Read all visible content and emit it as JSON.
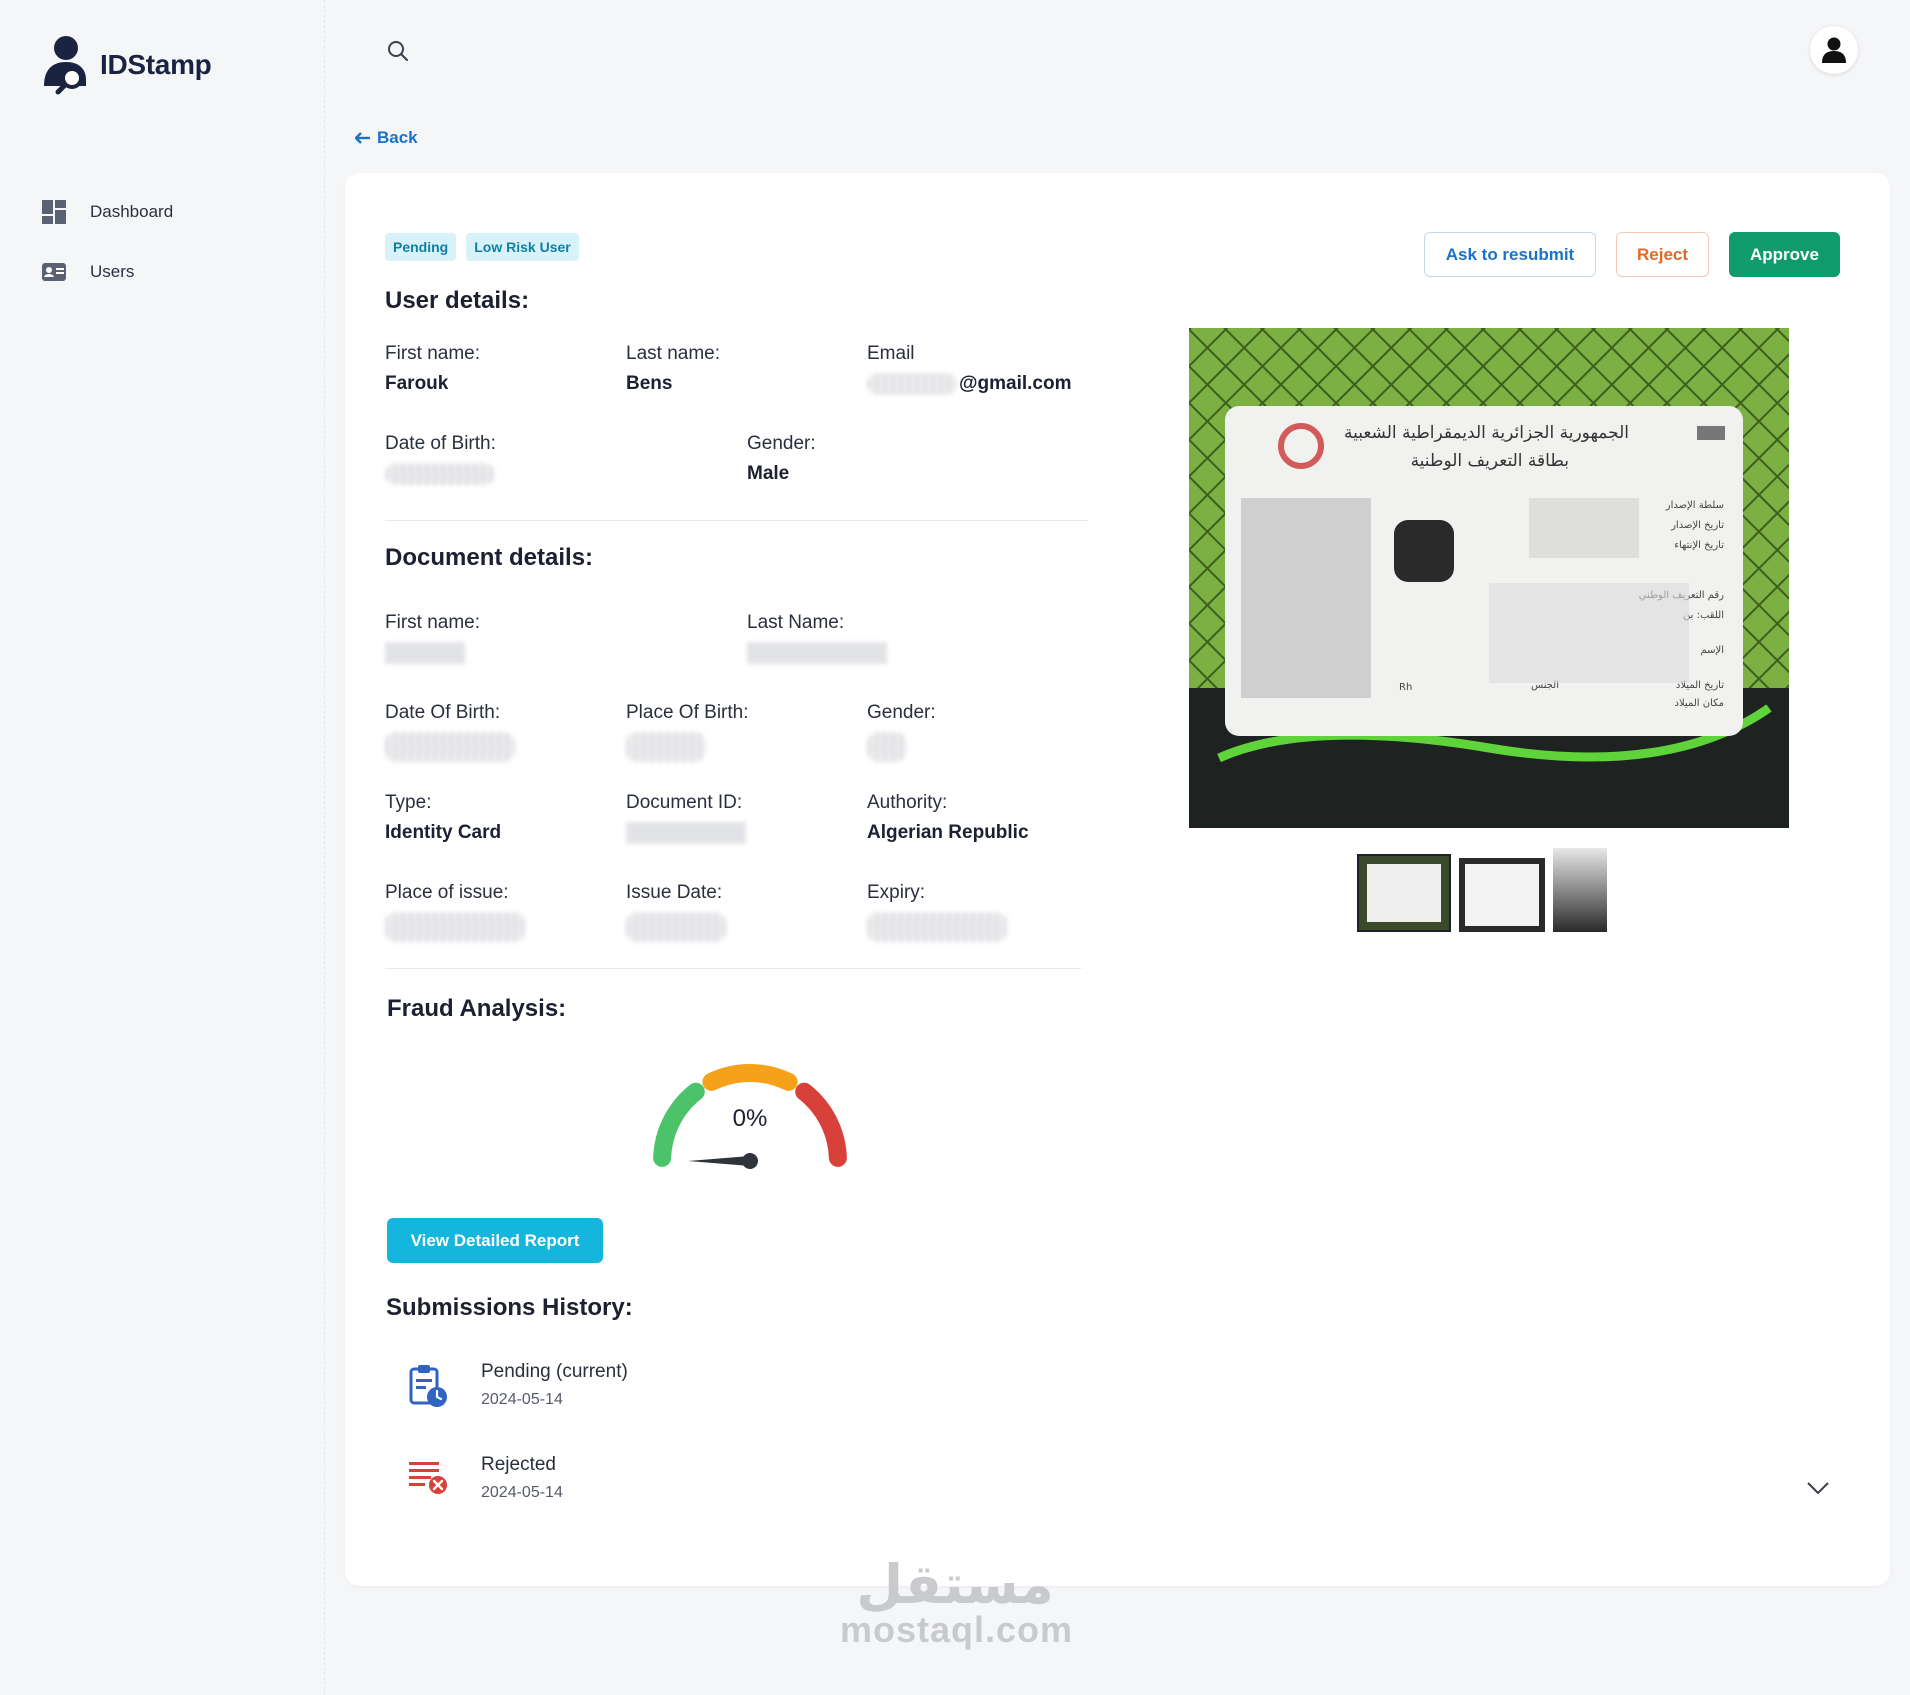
{
  "app": {
    "name": "IDStamp"
  },
  "sidebar": {
    "items": [
      {
        "label": "Dashboard",
        "icon": "dashboard-icon"
      },
      {
        "label": "Users",
        "icon": "id-card-icon"
      }
    ]
  },
  "header": {
    "search_icon": "search-icon",
    "avatar_icon": "user-icon"
  },
  "back_label": "Back",
  "status": {
    "badges": [
      "Pending",
      "Low Risk User"
    ]
  },
  "actions": {
    "resubmit": "Ask to resubmit",
    "reject": "Reject",
    "approve": "Approve"
  },
  "colors": {
    "primary_blue": "#1a73c9",
    "approve_green": "#0f9b6b",
    "reject_orange": "#e06a2c",
    "report_cyan": "#14b6de",
    "badge_bg": "#d7f2f8",
    "gauge_green": "#4cc36a",
    "gauge_orange": "#f5a11a",
    "gauge_red": "#d8403a"
  },
  "user_details": {
    "title": "User details:",
    "first_name": {
      "label": "First name:",
      "value": "Farouk"
    },
    "last_name": {
      "label": "Last name:",
      "value": "Bens"
    },
    "email": {
      "label": "Email",
      "value": "@gmail.com"
    },
    "dob": {
      "label": "Date of Birth:",
      "value": ""
    },
    "gender": {
      "label": "Gender:",
      "value": "Male"
    }
  },
  "document_details": {
    "title": "Document details:",
    "first_name": {
      "label": "First name:"
    },
    "last_name": {
      "label": "Last Name:"
    },
    "dob": {
      "label": "Date Of Birth:"
    },
    "place_of_birth": {
      "label": "Place Of Birth:"
    },
    "gender": {
      "label": "Gender:"
    },
    "type": {
      "label": "Type:",
      "value": "Identity Card"
    },
    "document_id": {
      "label": "Document ID:"
    },
    "authority": {
      "label": "Authority:",
      "value": "Algerian Republic"
    },
    "place_of_issue": {
      "label": "Place of issue:"
    },
    "issue_date": {
      "label": "Issue Date:"
    },
    "expiry": {
      "label": "Expiry:"
    }
  },
  "fraud": {
    "title": "Fraud Analysis:",
    "score_label": "0%",
    "score": 0,
    "report_button": "View Detailed Report"
  },
  "history": {
    "title": "Submissions History:",
    "items": [
      {
        "status": "Pending (current)",
        "date": "2024-05-14",
        "icon": "clipboard-clock-icon"
      },
      {
        "status": "Rejected",
        "date": "2024-05-14",
        "icon": "list-reject-icon"
      }
    ]
  },
  "document_image": {
    "line1": "الجمهورية الجزائرية الديمقراطية الشعبية",
    "line2": "بطاقة التعريف الوطنية",
    "fields": [
      "سلطة الإصدار",
      "تاريخ الإصدار",
      "تاريخ الإنتهاء",
      "رقم التعريف الوطني",
      "اللقب: بن",
      "الإسم",
      "تاريخ الميلاد",
      "مكان الميلاد",
      "الجنس",
      "Rh"
    ]
  },
  "watermark": {
    "arabic": "مستقل",
    "latin": "mostaql.com"
  }
}
